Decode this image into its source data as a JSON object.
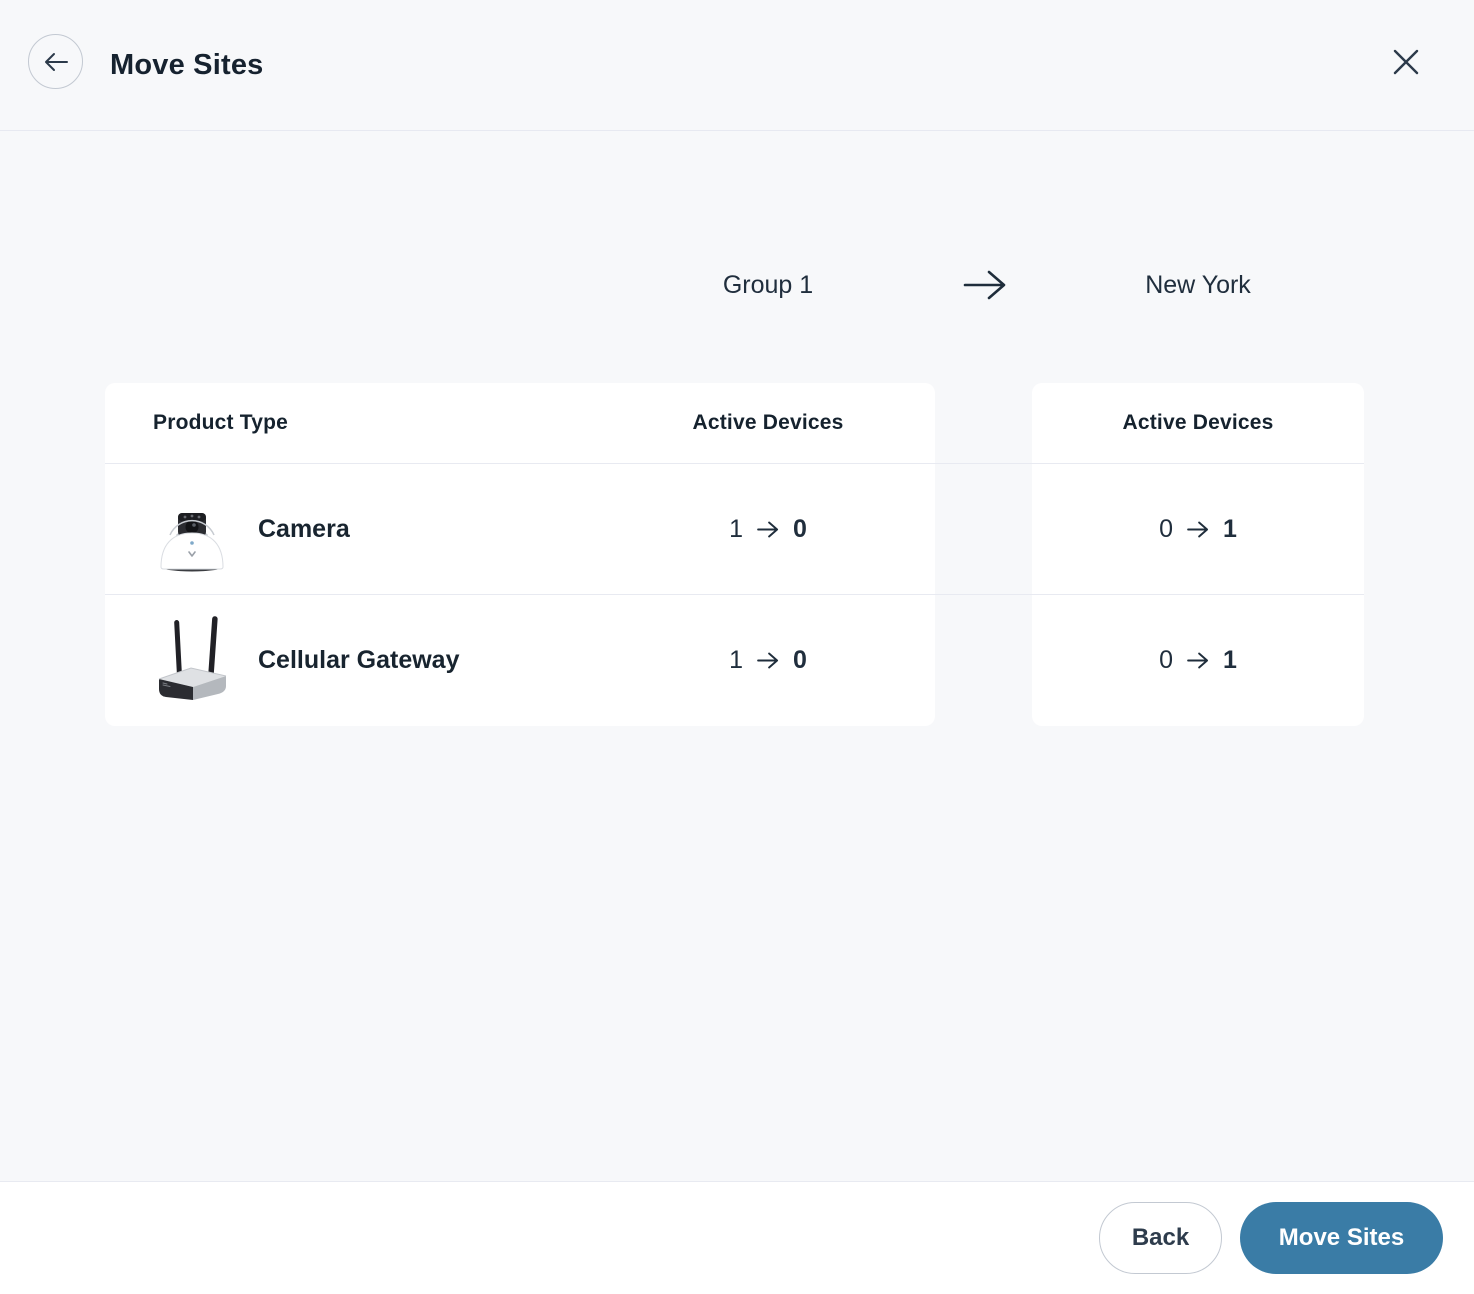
{
  "header": {
    "title": "Move Sites",
    "back_icon": "arrow-left",
    "close_icon": "x-close"
  },
  "transfer": {
    "source_group": "Group 1",
    "destination_group": "New York",
    "arrow_icon": "arrow-right"
  },
  "source_table": {
    "columns": {
      "product_type": "Product Type",
      "active_devices": "Active Devices"
    },
    "rows": [
      {
        "icon": "dome-camera",
        "product": "Camera",
        "from": "1",
        "to": "0"
      },
      {
        "icon": "cellular-gateway",
        "product": "Cellular Gateway",
        "from": "1",
        "to": "0"
      }
    ]
  },
  "destination_table": {
    "columns": {
      "active_devices": "Active Devices"
    },
    "rows": [
      {
        "from": "0",
        "to": "1"
      },
      {
        "from": "0",
        "to": "1"
      }
    ]
  },
  "footer": {
    "back_label": "Back",
    "move_label": "Move Sites"
  },
  "colors": {
    "accent_blue": "#3a7ca6",
    "text_dark": "#1d2b3a",
    "background": "#f7f8fa",
    "card": "#ffffff",
    "divider": "#e8eaf1"
  }
}
